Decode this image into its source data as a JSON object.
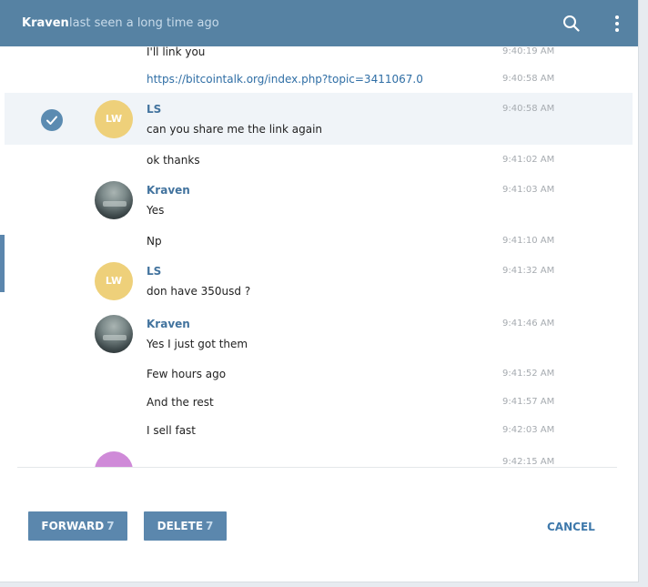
{
  "header": {
    "peer_name": "Kraven",
    "peer_status": "last seen a long time ago",
    "search_icon": "search-icon",
    "menu_icon": "more-vertical-icon"
  },
  "avatars": {
    "ls_initials": "LW"
  },
  "messages": [
    {
      "author": "",
      "text": "I'll link you",
      "time": "9:40:19 AM"
    },
    {
      "author": "",
      "text": "https://bitcointalk.org/index.php?topic=3411067.0",
      "time": "9:40:58 AM"
    },
    {
      "author": "LS",
      "text": "can you share me the link again",
      "time": "9:40:58 AM"
    },
    {
      "author": "",
      "text": "ok thanks",
      "time": "9:41:02 AM"
    },
    {
      "author": "Kraven",
      "text": "Yes",
      "time": "9:41:03 AM"
    },
    {
      "author": "",
      "text": "Np",
      "time": "9:41:10 AM"
    },
    {
      "author": "LS",
      "text": "don have 350usd  ?",
      "time": "9:41:32 AM"
    },
    {
      "author": "Kraven",
      "text": "Yes I just got them",
      "time": "9:41:46 AM"
    },
    {
      "author": "",
      "text": "Few hours ago",
      "time": "9:41:52 AM"
    },
    {
      "author": "",
      "text": "And the rest",
      "time": "9:41:57 AM"
    },
    {
      "author": "",
      "text": "I sell fast",
      "time": "9:42:03 AM"
    },
    {
      "author": "",
      "text": "",
      "time": "9:42:15 AM"
    }
  ],
  "actions": {
    "forward_label": "FORWARD",
    "forward_count": "7",
    "delete_label": "DELETE",
    "delete_count": "7",
    "cancel_label": "CANCEL"
  },
  "colors": {
    "header": "#5682a3",
    "accent": "#5b87ad",
    "author": "#42739e",
    "lw_avatar": "#eed07a",
    "purple_avatar": "#cf8ad8"
  }
}
